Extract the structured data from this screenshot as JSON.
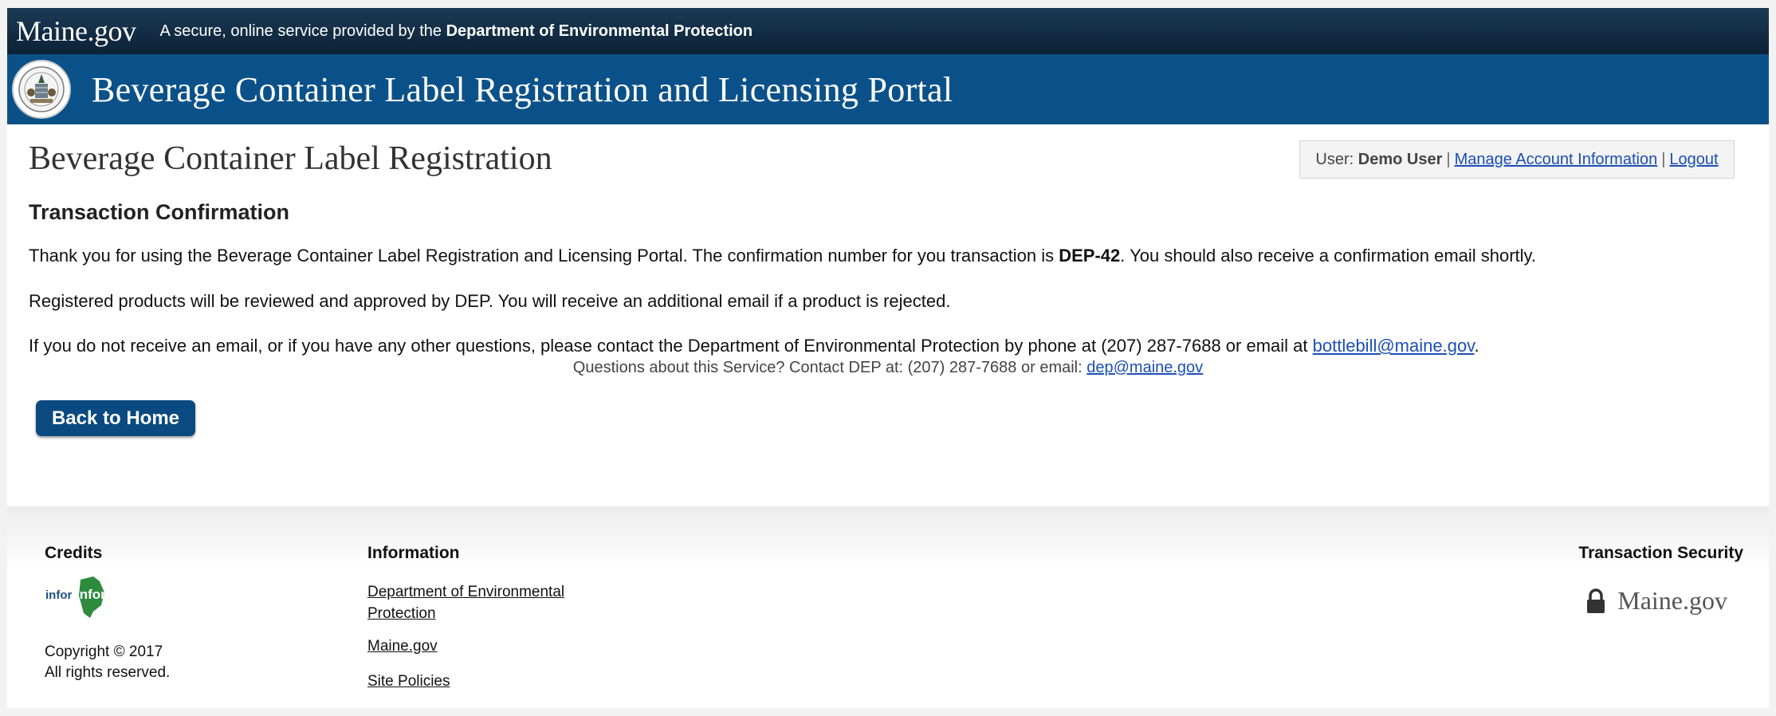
{
  "topbar": {
    "logo": "Maine.gov",
    "text_prefix": "A secure, online service provided by the",
    "text_bold": "Department of Environmental Protection"
  },
  "banner": {
    "title": "Beverage Container Label Registration and Licensing Portal"
  },
  "page_title": "Beverage Container Label Registration",
  "user": {
    "label": "User:",
    "name": "Demo User",
    "separator": "|",
    "manage_link": "Manage Account Information",
    "logout_link": "Logout"
  },
  "section_title": "Transaction Confirmation",
  "para1": {
    "before": "Thank you for using the Beverage Container Label Registration and Licensing Portal. The confirmation number for you transaction is",
    "number": "DEP-42",
    "after": ". You should also receive a confirmation email shortly."
  },
  "para2": "Registered products will be reviewed and approved by DEP. You will receive an additional email if a product is rejected.",
  "para3": {
    "before": "If you do not receive an email, or if you have any other questions, please contact the Department of Environmental Protection by phone at (207) 287-7688 or email at",
    "email": "bottlebill@maine.gov",
    "after": "."
  },
  "back_button": "Back to Home",
  "questions": {
    "text": "Questions about this Service? Contact DEP at: (207) 287-7688 or email:",
    "email": "dep@maine.gov"
  },
  "footer": {
    "credits_title": "Credits",
    "infome_logo": "inforME",
    "copyright": "Copyright © 2017",
    "rights": "All rights reserved.",
    "info_title": "Information",
    "links": [
      "Department of Environmental",
      "Protection",
      "Maine.gov",
      "Site Policies"
    ],
    "security_title": "Transaction Security",
    "security_logo": "Maine.gov"
  },
  "icons": {
    "lock": "lock-icon",
    "seal": "maine-seal-icon"
  },
  "colors": {
    "topbar": "#0c2236",
    "banner": "#0b5189",
    "button": "#0b4a80",
    "link": "#1b4fb5"
  }
}
